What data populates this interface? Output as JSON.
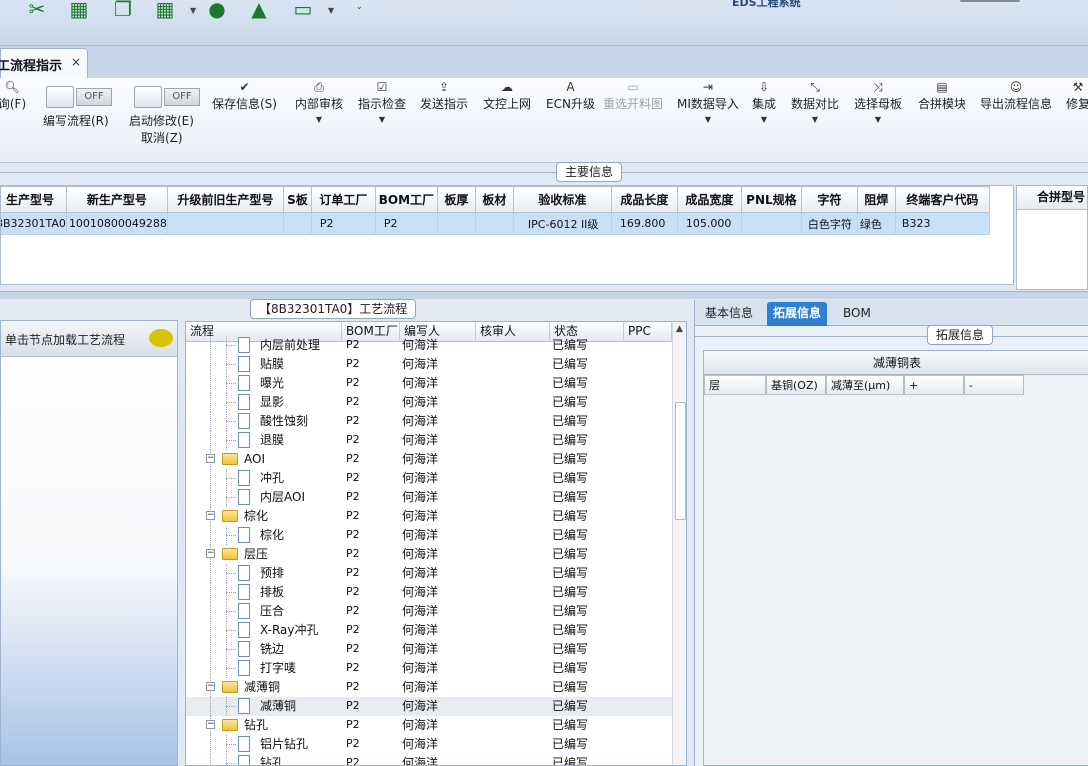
{
  "app": {
    "title": "EDS工程系统"
  },
  "tab": {
    "label": "工流程指示",
    "close": "×"
  },
  "ribbon": {
    "query": {
      "label": "询(F)"
    },
    "edit_flow": {
      "toggle": "OFF",
      "label": "编写流程(R)"
    },
    "start_modify": {
      "toggle": "OFF",
      "label": "启动修改(E)",
      "sub": "取消(Z)"
    },
    "items": [
      {
        "label": "保存信息(S)",
        "icon": "✔",
        "disabled": true,
        "dropdown": false
      },
      {
        "label": "内部审核",
        "icon": "⎙",
        "disabled": false,
        "dropdown": true
      },
      {
        "label": "指示检查",
        "icon": "☑",
        "disabled": false,
        "dropdown": true
      },
      {
        "label": "发送指示",
        "icon": "⇪",
        "disabled": false,
        "dropdown": false
      },
      {
        "label": "文控上网",
        "icon": "☁",
        "disabled": false,
        "dropdown": false
      },
      {
        "label": "ECN升级",
        "icon": "A",
        "disabled": false,
        "dropdown": false
      },
      {
        "label": "重选开料图",
        "icon": "▭",
        "disabled": true,
        "dropdown": false
      },
      {
        "label": "MI数据导入",
        "icon": "⇥",
        "disabled": false,
        "dropdown": true
      },
      {
        "label": "集成",
        "icon": "⇩",
        "disabled": false,
        "dropdown": true
      },
      {
        "label": "数据对比",
        "icon": "⤡",
        "disabled": false,
        "dropdown": true
      },
      {
        "label": "选择母板",
        "icon": "⤨",
        "disabled": false,
        "dropdown": true
      },
      {
        "label": "合拼模块",
        "icon": "▤",
        "disabled": false,
        "dropdown": false
      },
      {
        "label": "导出流程信息",
        "icon": "☺",
        "disabled": false,
        "dropdown": false
      },
      {
        "label": "修复",
        "icon": "⚒",
        "disabled": false,
        "dropdown": false
      }
    ]
  },
  "main_info": {
    "title": "主要信息",
    "columns": [
      "生产型号",
      "新生产型号",
      "升级前旧生产型号",
      "S板",
      "订单工厂",
      "BOM工厂",
      "板厚",
      "板材",
      "验收标准",
      "成品长度",
      "成品宽度",
      "PNL规格",
      "字符",
      "阻焊",
      "终端客户代码"
    ],
    "row": [
      "8B32301TA0",
      "10010800049288",
      "",
      "",
      "P2",
      "P2",
      "",
      "",
      "IPC-6012 II级",
      "169.800",
      "105.000",
      "",
      "白色字符",
      "绿色",
      "B323"
    ],
    "side_column": "合拼型号"
  },
  "left_panel": {
    "header": "单击节点加载工艺流程"
  },
  "process": {
    "title": "【8B32301TA0】工艺流程",
    "columns": [
      "流程",
      "BOM工厂",
      "编写人",
      "核审人",
      "状态",
      "PPC"
    ],
    "rows": [
      {
        "name": "内层前处理",
        "level": 2,
        "type": "doc",
        "bom": "P2",
        "writer": "何海洋",
        "reviewer": "",
        "status": "已编写",
        "ppc": "",
        "selected": false
      },
      {
        "name": "贴膜",
        "level": 2,
        "type": "doc",
        "bom": "P2",
        "writer": "何海洋",
        "reviewer": "",
        "status": "已编写",
        "ppc": "",
        "selected": false
      },
      {
        "name": "曝光",
        "level": 2,
        "type": "doc",
        "bom": "P2",
        "writer": "何海洋",
        "reviewer": "",
        "status": "已编写",
        "ppc": "",
        "selected": false
      },
      {
        "name": "显影",
        "level": 2,
        "type": "doc",
        "bom": "P2",
        "writer": "何海洋",
        "reviewer": "",
        "status": "已编写",
        "ppc": "",
        "selected": false
      },
      {
        "name": "酸性蚀刻",
        "level": 2,
        "type": "doc",
        "bom": "P2",
        "writer": "何海洋",
        "reviewer": "",
        "status": "已编写",
        "ppc": "",
        "selected": false
      },
      {
        "name": "退膜",
        "level": 2,
        "type": "doc",
        "bom": "P2",
        "writer": "何海洋",
        "reviewer": "",
        "status": "已编写",
        "ppc": "",
        "selected": false
      },
      {
        "name": "AOI",
        "level": 1,
        "type": "folder",
        "bom": "P2",
        "writer": "何海洋",
        "reviewer": "",
        "status": "已编写",
        "ppc": "",
        "selected": false
      },
      {
        "name": "冲孔",
        "level": 2,
        "type": "doc",
        "bom": "P2",
        "writer": "何海洋",
        "reviewer": "",
        "status": "已编写",
        "ppc": "",
        "selected": false
      },
      {
        "name": "内层AOI",
        "level": 2,
        "type": "doc",
        "bom": "P2",
        "writer": "何海洋",
        "reviewer": "",
        "status": "已编写",
        "ppc": "",
        "selected": false
      },
      {
        "name": "棕化",
        "level": 1,
        "type": "folder",
        "bom": "P2",
        "writer": "何海洋",
        "reviewer": "",
        "status": "已编写",
        "ppc": "",
        "selected": false
      },
      {
        "name": "棕化",
        "level": 2,
        "type": "doc",
        "bom": "P2",
        "writer": "何海洋",
        "reviewer": "",
        "status": "已编写",
        "ppc": "",
        "selected": false
      },
      {
        "name": "层压",
        "level": 1,
        "type": "folder",
        "bom": "P2",
        "writer": "何海洋",
        "reviewer": "",
        "status": "已编写",
        "ppc": "",
        "selected": false
      },
      {
        "name": "预排",
        "level": 2,
        "type": "doc",
        "bom": "P2",
        "writer": "何海洋",
        "reviewer": "",
        "status": "已编写",
        "ppc": "",
        "selected": false
      },
      {
        "name": "排板",
        "level": 2,
        "type": "doc",
        "bom": "P2",
        "writer": "何海洋",
        "reviewer": "",
        "status": "已编写",
        "ppc": "",
        "selected": false
      },
      {
        "name": "压合",
        "level": 2,
        "type": "doc",
        "bom": "P2",
        "writer": "何海洋",
        "reviewer": "",
        "status": "已编写",
        "ppc": "",
        "selected": false
      },
      {
        "name": "X-Ray冲孔",
        "level": 2,
        "type": "doc",
        "bom": "P2",
        "writer": "何海洋",
        "reviewer": "",
        "status": "已编写",
        "ppc": "",
        "selected": false
      },
      {
        "name": "铣边",
        "level": 2,
        "type": "doc",
        "bom": "P2",
        "writer": "何海洋",
        "reviewer": "",
        "status": "已编写",
        "ppc": "",
        "selected": false
      },
      {
        "name": "打字唛",
        "level": 2,
        "type": "doc",
        "bom": "P2",
        "writer": "何海洋",
        "reviewer": "",
        "status": "已编写",
        "ppc": "",
        "selected": false
      },
      {
        "name": "减薄铜",
        "level": 1,
        "type": "folder",
        "bom": "P2",
        "writer": "何海洋",
        "reviewer": "",
        "status": "已编写",
        "ppc": "",
        "selected": false
      },
      {
        "name": "减薄铜",
        "level": 2,
        "type": "doc",
        "bom": "P2",
        "writer": "何海洋",
        "reviewer": "",
        "status": "已编写",
        "ppc": "",
        "selected": true
      },
      {
        "name": "钻孔",
        "level": 1,
        "type": "folder",
        "bom": "P2",
        "writer": "何海洋",
        "reviewer": "",
        "status": "已编写",
        "ppc": "",
        "selected": false
      },
      {
        "name": "铝片钻孔",
        "level": 2,
        "type": "doc",
        "bom": "P2",
        "writer": "何海洋",
        "reviewer": "",
        "status": "已编写",
        "ppc": "",
        "selected": false
      },
      {
        "name": "钻孔",
        "level": 2,
        "type": "doc",
        "bom": "P2",
        "writer": "何海洋",
        "reviewer": "",
        "status": "已编写",
        "ppc": "",
        "selected": false
      }
    ]
  },
  "right_panel": {
    "tabs": [
      "基本信息",
      "拓展信息",
      "BOM"
    ],
    "active_tab": "拓展信息",
    "section": "拓展信息",
    "table_title": "减薄铜表",
    "columns": [
      "层",
      "基铜(OZ)",
      "减薄至(μm)",
      "+",
      "-"
    ]
  }
}
